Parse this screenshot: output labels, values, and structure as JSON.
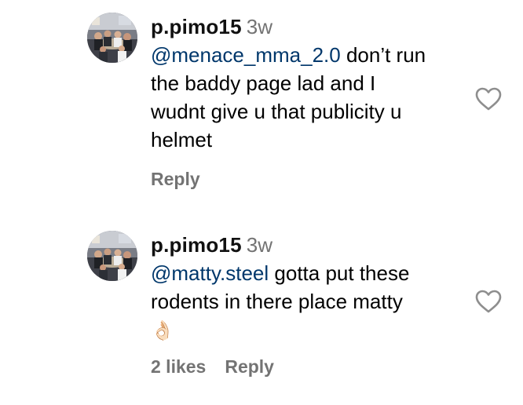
{
  "comments": [
    {
      "username": "p.pimo15",
      "timestamp": "3w",
      "mention": "@menace_mma_2.0",
      "text_line1_rest": " don’t run",
      "text_lines": [
        "the baddy page lad and I",
        "wudnt give u that publicity u",
        "helmet"
      ],
      "reply_label": "Reply",
      "avatar_icon": "group-photo",
      "like_icon": "heart-outline-icon"
    },
    {
      "username": "p.pimo15",
      "timestamp": "3w",
      "mention": "@matty.steel",
      "text_line1_rest": " gotta put these",
      "text_lines": [
        "rodents in there place matty"
      ],
      "emoji": "👌🏻",
      "likes_label": "2 likes",
      "reply_label": "Reply",
      "avatar_icon": "group-photo",
      "like_icon": "heart-outline-icon"
    }
  ],
  "colors": {
    "text": "#000000",
    "username": "#111111",
    "muted": "#737373",
    "mention": "#00376b",
    "heart_stroke": "#8e8e8e"
  }
}
